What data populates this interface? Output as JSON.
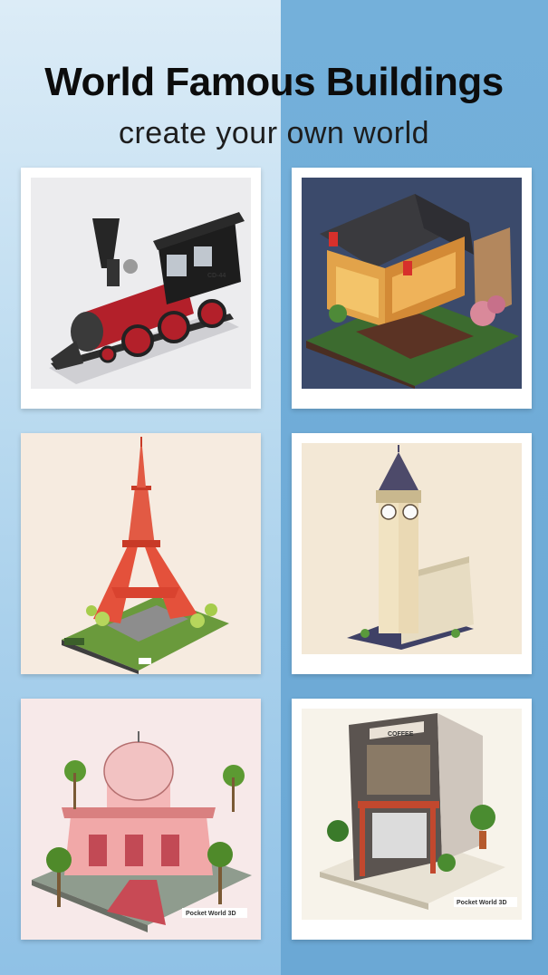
{
  "header": {
    "title": "World Famous Buildings",
    "subtitle": "create your own world"
  },
  "cards": [
    {
      "subject": "steam locomotive",
      "icon": "train-model",
      "caption": "CD-44"
    },
    {
      "subject": "japanese tea house",
      "icon": "teahouse-model"
    },
    {
      "subject": "eiffel tower",
      "icon": "eiffel-tower-model"
    },
    {
      "subject": "big ben",
      "icon": "big-ben-model"
    },
    {
      "subject": "domed palace",
      "icon": "palace-model",
      "watermark": "Pocket World 3D"
    },
    {
      "subject": "coffee shop",
      "icon": "cafe-model",
      "sign": "COFFEE",
      "watermark": "Pocket World 3D"
    }
  ],
  "colors": {
    "background_left": "#cfe6f5",
    "background_right": "#6ba8d5",
    "card": "#ffffff",
    "title_text": "#0c0c0c"
  }
}
